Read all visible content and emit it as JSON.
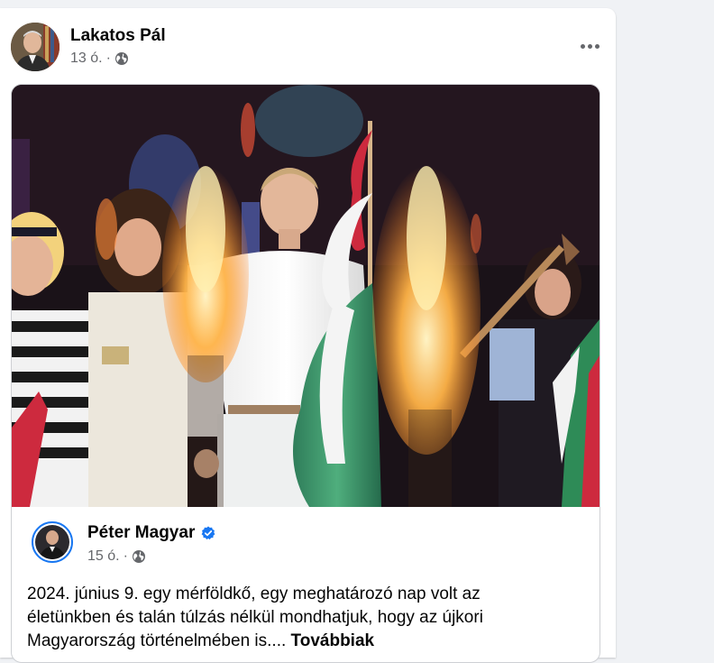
{
  "post": {
    "author": "Lakatos Pál",
    "time": "13 ó.",
    "separator": "·",
    "audience_icon": "globe-icon",
    "more_icon": "more-options-icon"
  },
  "shared": {
    "author": "Péter Magyar",
    "verified_icon": "verified-badge-icon",
    "time": "15 ó.",
    "separator": "·",
    "audience_icon": "globe-icon",
    "text": "2024. június 9. egy mérföldkő, egy meghatározó nap volt az életünkben és talán túlzás nélkül mondhatjuk, hogy az újkori Magyarország történelmében is.... ",
    "see_more": "Továbbiak"
  },
  "colors": {
    "page_bg": "#f0f2f5",
    "card_bg": "#ffffff",
    "secondary_text": "#65676b",
    "accent_blue": "#1877f2",
    "flag_red": "#cd2a3e",
    "flag_green": "#2e8b57"
  }
}
